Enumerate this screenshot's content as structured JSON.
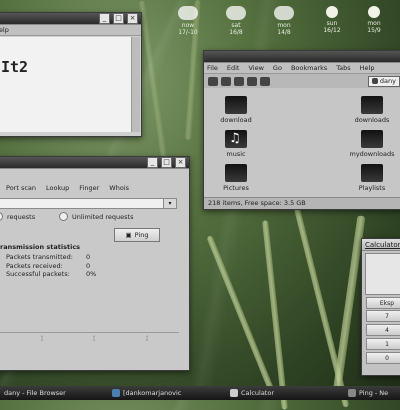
{
  "weather": {
    "days": [
      {
        "label": "now",
        "temp": "17/-10"
      },
      {
        "label": "sat",
        "temp": "16/8"
      },
      {
        "label": "mon",
        "temp": "14/8"
      },
      {
        "label": "sun",
        "temp": "16/12"
      },
      {
        "label": "mon",
        "temp": "15/9"
      }
    ]
  },
  "editor": {
    "title": "Help",
    "minimize": "_",
    "maximize": "□",
    "close": "×",
    "content": "It2"
  },
  "file_browser": {
    "menu": [
      "File",
      "Edit",
      "View",
      "Go",
      "Bookmarks",
      "Tabs",
      "Help"
    ],
    "location": "dany",
    "folders": [
      {
        "label": "download",
        "icon": "folder-icon"
      },
      {
        "label": "downloads",
        "icon": "folder-icon"
      },
      {
        "label": "music",
        "icon": "music-folder-icon"
      },
      {
        "label": "mydownloads",
        "icon": "folder-icon"
      },
      {
        "label": "Pictures",
        "icon": "folder-icon"
      },
      {
        "label": "Playlists",
        "icon": "folder-icon"
      }
    ],
    "status": "218 items, Free space: 3.5 GB"
  },
  "network": {
    "minimize": "_",
    "maximize": "□",
    "close": "×",
    "tabs": [
      "Port scan",
      "Lookup",
      "Finger",
      "Whois"
    ],
    "radio_requests": "requests",
    "radio_unlimited": "Unlimited requests",
    "ping_label": "Ping",
    "stats_title": "ransmission statistics",
    "stats": [
      {
        "label": "Packets transmitted:",
        "value": "0"
      },
      {
        "label": "Packets received:",
        "value": "0"
      },
      {
        "label": "Successful packets:",
        "value": "0%"
      }
    ]
  },
  "calculator": {
    "title": "Calculator",
    "buttons": [
      "Eksp",
      "7",
      "4",
      "1",
      "0"
    ]
  },
  "taskbar": {
    "items": [
      {
        "label": "dany - File Browser"
      },
      {
        "label": "[dankomarjanovic"
      },
      {
        "label": "Calculator"
      },
      {
        "label": "Ping - Ne"
      }
    ]
  },
  "colors": {
    "accent": "#c9c9c9",
    "taskbar": "#2a2a2a"
  }
}
